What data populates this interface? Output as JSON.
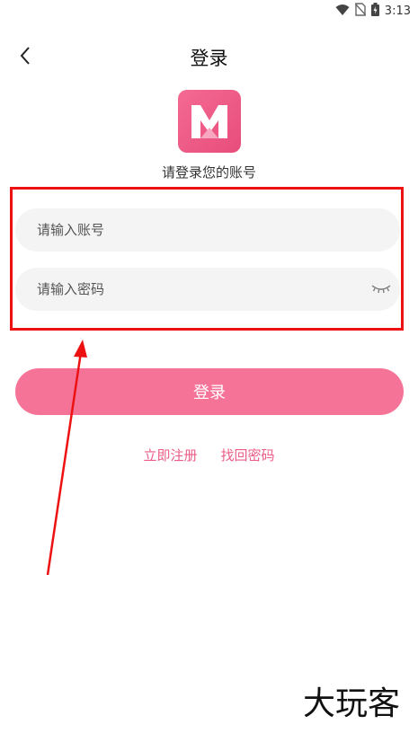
{
  "status_bar": {
    "time": "3:13"
  },
  "header": {
    "title": "登录"
  },
  "subtitle": "请登录您的账号",
  "form": {
    "account_placeholder": "请输入账号",
    "account_value": "",
    "password_placeholder": "请输入密码",
    "password_value": ""
  },
  "login_button_label": "登录",
  "links": {
    "register": "立即注册",
    "recover": "找回密码"
  },
  "watermark": "大玩客",
  "colors": {
    "accent": "#f67398",
    "link": "#ec5c87",
    "annotation": "#ee1111"
  }
}
